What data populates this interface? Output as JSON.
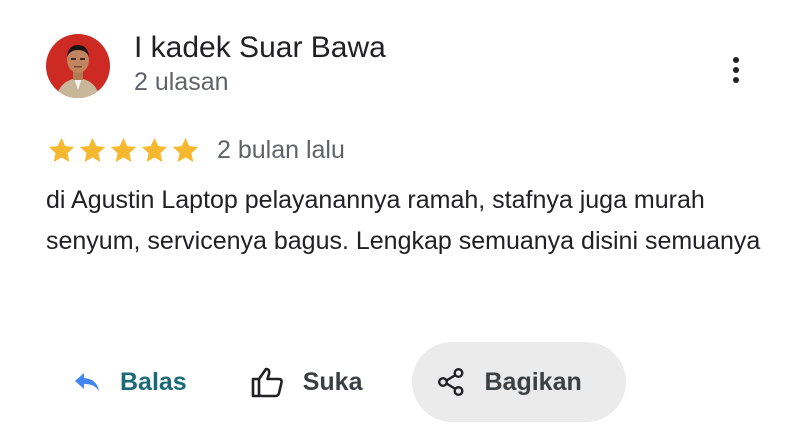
{
  "reviewer": {
    "name": "I kadek Suar Bawa",
    "meta": "2 ulasan",
    "avatar_icon": "reviewer-photo"
  },
  "more_icon": "three-dots-vertical-icon",
  "review": {
    "rating": 5,
    "max_rating": 5,
    "date": "2 bulan lalu",
    "text": "di Agustin Laptop pelayanannya ramah, stafnya juga murah senyum, servicenya bagus. Lengkap semuanya disini semuanya"
  },
  "actions": {
    "reply": {
      "label": "Balas",
      "icon": "reply-arrow-icon"
    },
    "like": {
      "label": "Suka",
      "icon": "thumbs-up-icon"
    },
    "share": {
      "label": "Bagikan",
      "icon": "share-icon"
    }
  },
  "colors": {
    "star": "#f5b82e",
    "reply_accent": "#1a6a78",
    "reply_icon": "#4285f4",
    "share_bg": "#ebebeb",
    "avatar_bg": "#cc2a22"
  }
}
